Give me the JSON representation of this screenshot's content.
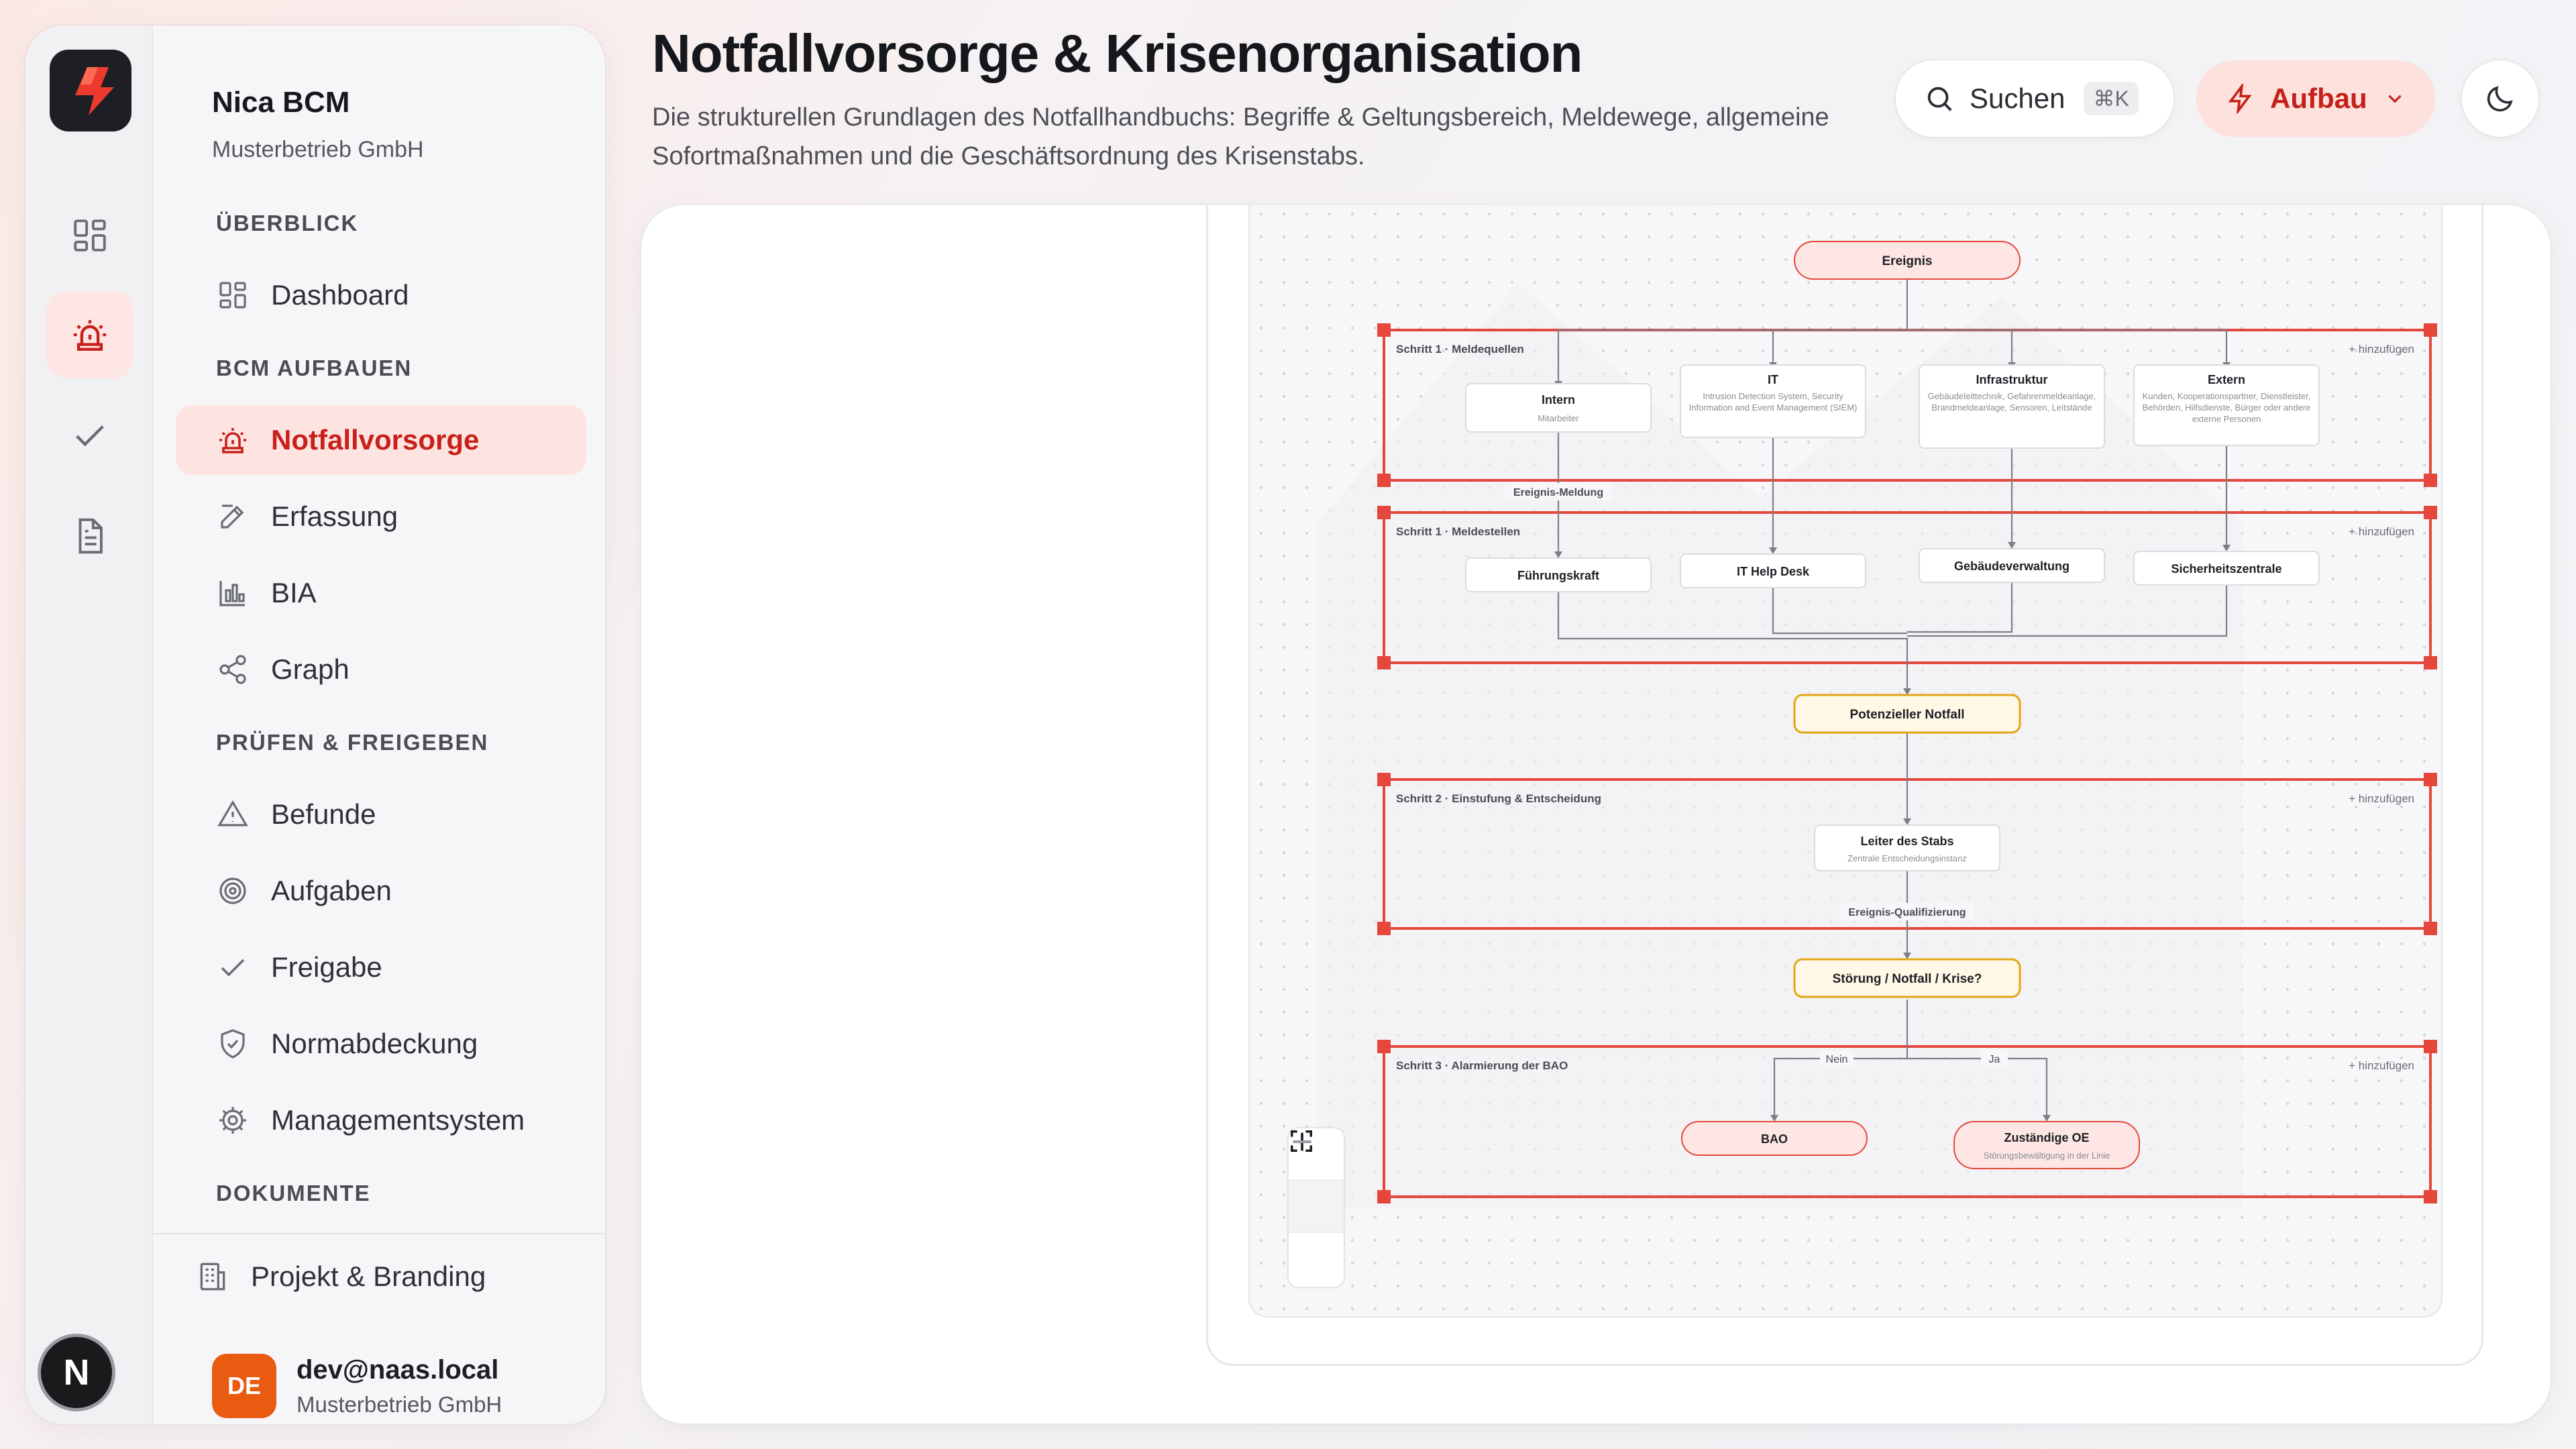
{
  "sidebar": {
    "org_name": "Nica BCM",
    "org_sub": "Musterbetrieb GmbH",
    "sections": {
      "overview": "ÜBERBLICK",
      "build": "BCM AUFBAUEN",
      "review": "PRÜFEN & FREIGEBEN",
      "docs": "DOKUMENTE"
    },
    "items": [
      {
        "label": "Dashboard",
        "icon": "dashboard-icon"
      },
      {
        "label": "Notfallvorsorge",
        "icon": "siren-icon",
        "active": true
      },
      {
        "label": "Erfassung",
        "icon": "edit-icon"
      },
      {
        "label": "BIA",
        "icon": "bar-chart-icon"
      },
      {
        "label": "Graph",
        "icon": "share-icon"
      },
      {
        "label": "Befunde",
        "icon": "warning-icon"
      },
      {
        "label": "Aufgaben",
        "icon": "target-icon"
      },
      {
        "label": "Freigabe",
        "icon": "check-icon"
      },
      {
        "label": "Normabdeckung",
        "icon": "shield-check-icon"
      },
      {
        "label": "Managementsystem",
        "icon": "gear-icon"
      }
    ],
    "project_label": "Projekt & Branding",
    "user": {
      "initials": "DE",
      "email": "dev@naas.local",
      "org": "Musterbetrieb GmbH"
    },
    "avatar_letter": "N"
  },
  "header": {
    "title": "Notfallvorsorge & Krisenorganisation",
    "description": "Die strukturellen Grundlagen des Notfallhandbuchs: Begriffe & Geltungsbereich, Meldewege, allgemeine Sofortmaßnahmen und die Geschäftsordnung des Krisenstabs.",
    "search_label": "Suchen",
    "search_shortcut": "⌘K",
    "mode_label": "Aufbau"
  },
  "diagram": {
    "start_node": "Ereignis",
    "add_label": "+ hinzufügen",
    "lane1": {
      "title": "Schritt 1 · Meldequellen",
      "nodes": [
        {
          "title": "Intern",
          "sub": "Mitarbeiter"
        },
        {
          "title": "IT",
          "sub": "Intrusion Detection System, Security Information and Event Management (SIEM)"
        },
        {
          "title": "Infrastruktur",
          "sub": "Gebäudeleittechnik, Gefahrenmeldeanlage, Brandmeldeanlage, Sensoren, Leitstände"
        },
        {
          "title": "Extern",
          "sub": "Kunden, Kooperationspartner, Dienstleister, Behörden, Hilfsdienste, Bürger oder andere externe Personen"
        }
      ]
    },
    "edge_meldung": "Ereignis-Meldung",
    "lane2": {
      "title": "Schritt 1 · Meldestellen",
      "nodes": [
        "Führungskraft",
        "IT Help Desk",
        "Gebäudeverwaltung",
        "Sicherheitszentrale"
      ]
    },
    "potential_node": "Potenzieller Notfall",
    "lane3": {
      "title": "Schritt 2 · Einstufung & Entscheidung",
      "node_title": "Leiter des Stabs",
      "node_sub": "Zentrale Entscheidungsinstanz"
    },
    "edge_qualifizierung": "Ereignis-Qualifizierung",
    "decision_node": "Störung / Notfall / Krise?",
    "lane4": {
      "title": "Schritt 3 · Alarmierung der BAO",
      "edge_no": "Nein",
      "edge_yes": "Ja",
      "node_bao": "BAO",
      "node_oe_title": "Zuständige OE",
      "node_oe_sub": "Störungsbewältigung in der Linie"
    }
  },
  "colors": {
    "accent": "#c8201a",
    "accent_bg": "#fde4e1",
    "lane_border": "#e5473c",
    "warning_node_border": "#e3a514",
    "warning_node_bg": "#fff8e6"
  }
}
